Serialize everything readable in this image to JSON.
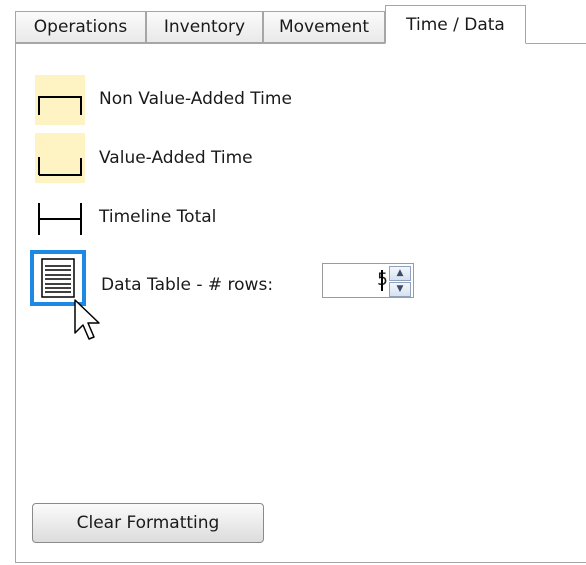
{
  "tabs": [
    {
      "label": "Operations",
      "active": false
    },
    {
      "label": "Inventory",
      "active": false
    },
    {
      "label": "Movement",
      "active": false
    },
    {
      "label": "Time / Data",
      "active": true
    }
  ],
  "items": {
    "nva_label": "Non Value-Added Time",
    "va_label": "Value-Added Time",
    "total_label": "Timeline Total",
    "table_label": "Data Table - # rows:"
  },
  "rows_input": {
    "value": "5"
  },
  "clear_button": {
    "label": "Clear Formatting"
  },
  "colors": {
    "accent": "#1e88e5",
    "symbol_fill": "#fdf3c3"
  }
}
